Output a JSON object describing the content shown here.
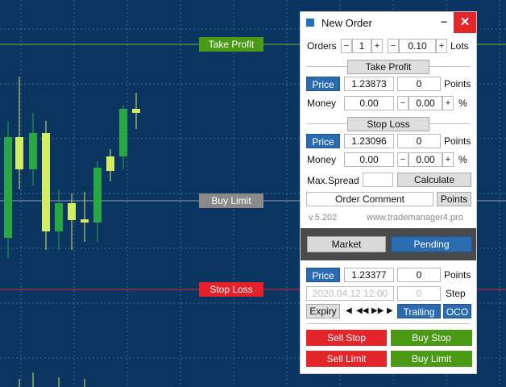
{
  "chart": {
    "colors": {
      "background": "#0a3560",
      "grid": "#5a7fa6",
      "bull_candle": "#27a843",
      "bear_candle": "#d4ec64",
      "take_profit_line": "#7fb22c",
      "buy_limit_line": "#9aa0a8",
      "stop_loss_line": "#e5202a"
    },
    "take_profit_label": "Take Profit",
    "buy_limit_label": "Buy Limit",
    "stop_loss_label": "Stop Loss"
  },
  "panel": {
    "title": "New Order",
    "minimize_glyph": "–",
    "close_glyph": "✕",
    "orders_label": "Orders",
    "orders_value": "1",
    "lots_value": "0.10",
    "lots_label": "Lots",
    "minus": "−",
    "plus": "+",
    "take_profit": {
      "header": "Take Profit",
      "price_btn": "Price",
      "price": "1.23873",
      "points": "0",
      "points_label": "Points",
      "money_label": "Money",
      "money": "0.00",
      "percent": "0.00",
      "percent_label": "%"
    },
    "stop_loss": {
      "header": "Stop Loss",
      "price_btn": "Price",
      "price": "1.23096",
      "points": "0",
      "points_label": "Points",
      "money_label": "Money",
      "money": "0.00",
      "percent": "0.00",
      "percent_label": "%"
    },
    "max_spread_label": "Max.Spread",
    "max_spread_value": "",
    "calculate_btn": "Calculate",
    "order_comment_btn": "Order Comment",
    "points_btn": "Points",
    "version": "v.5.202",
    "website": "www.trademanager4.pro",
    "market_btn": "Market",
    "pending_btn": "Pending",
    "pending": {
      "price_btn": "Price",
      "price": "1.23377",
      "points": "0",
      "points_label": "Points",
      "expiry_datetime": "2020.04.12 12:00",
      "step_value": "0",
      "step_label": "Step",
      "expiry_btn": "Expiry",
      "nav_first": "◀",
      "nav_back": "◀◀",
      "nav_fwd": "▶▶",
      "nav_last": "▶",
      "trailing_btn": "Trailing",
      "oco_btn": "OCO"
    },
    "sell_stop_btn": "Sell Stop",
    "buy_stop_btn": "Buy Stop",
    "sell_limit_btn": "Sell Limit",
    "buy_limit_btn": "Buy Limit"
  }
}
